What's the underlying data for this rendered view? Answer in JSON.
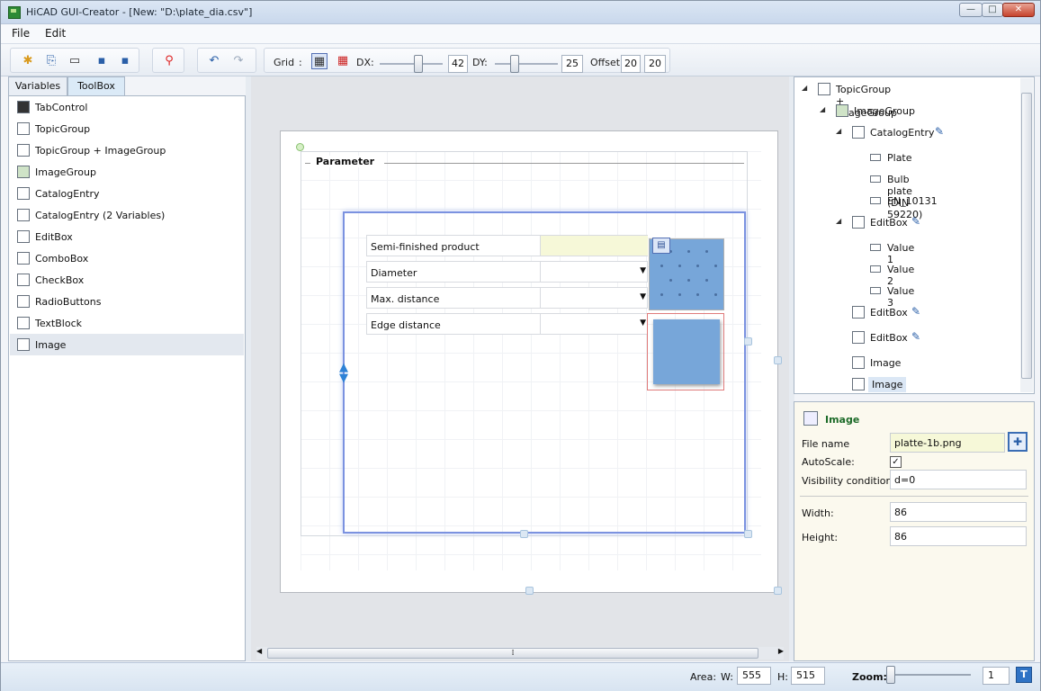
{
  "window": {
    "title": "HiCAD GUI-Creator - [New: \"D:\\plate_dia.csv\"]",
    "min": "—",
    "max": "□",
    "close": "✕"
  },
  "menu": {
    "file": "File",
    "edit": "Edit"
  },
  "toolbar": {
    "grid_label": "Grid",
    "grid_colon": ":",
    "dx_label": "DX:",
    "dx_value": "42",
    "dy_label": "DY:",
    "dy_value": "25",
    "offset_label": "Offset:",
    "offset_x": "20",
    "offset_y": "20",
    "icons": [
      "new-icon",
      "open-template-icon",
      "open-icon",
      "save-icon",
      "save-as-icon",
      "plugin-icon",
      "undo-icon",
      "redo-icon",
      "grid-toggle-icon",
      "snap-icon"
    ]
  },
  "left": {
    "tabs": [
      {
        "label": "Variables"
      },
      {
        "label": "ToolBox"
      }
    ],
    "items": [
      {
        "label": "TabControl",
        "icon": "tabcontrol-icon"
      },
      {
        "label": "TopicGroup",
        "icon": "topicgroup-icon"
      },
      {
        "label": "TopicGroup + ImageGroup",
        "icon": "topic-image-group-icon"
      },
      {
        "label": "ImageGroup",
        "icon": "imagegroup-icon"
      },
      {
        "label": "CatalogEntry",
        "icon": "catalogentry-icon"
      },
      {
        "label": "CatalogEntry (2 Variables)",
        "icon": "catalogentry2-icon"
      },
      {
        "label": "EditBox",
        "icon": "editbox-icon"
      },
      {
        "label": "ComboBox",
        "icon": "combobox-icon"
      },
      {
        "label": "CheckBox",
        "icon": "checkbox-icon"
      },
      {
        "label": "RadioButtons",
        "icon": "radiobuttons-icon"
      },
      {
        "label": "TextBlock",
        "icon": "textblock-icon"
      },
      {
        "label": "Image",
        "icon": "image-icon"
      }
    ],
    "selected": "Image"
  },
  "canvas": {
    "group_title": "Parameter",
    "rows": [
      {
        "label": "Semi-finished product",
        "value": ""
      },
      {
        "label": "Diameter",
        "value": ""
      },
      {
        "label": "Max. distance",
        "value": ""
      },
      {
        "label": "Edge distance",
        "value": ""
      }
    ]
  },
  "tree": {
    "nodes": [
      {
        "label": "TopicGroup + ImageGroup"
      },
      {
        "label": "ImageGroup"
      },
      {
        "label": "CatalogEntry"
      },
      {
        "label": "Plate"
      },
      {
        "label": "Bulb plate (DIN 59220)"
      },
      {
        "label": "EN_10131"
      },
      {
        "label": "EditBox"
      },
      {
        "label": "Value 1"
      },
      {
        "label": "Value 2"
      },
      {
        "label": "Value 3"
      },
      {
        "label": "EditBox"
      },
      {
        "label": "EditBox"
      },
      {
        "label": "Image"
      },
      {
        "label": "Image"
      }
    ]
  },
  "props": {
    "header": "Image",
    "file_name_label": "File name",
    "file_name_value": "platte-1b.png",
    "autoscale_label": "AutoScale:",
    "autoscale_checked": "✓",
    "visibility_label": "Visibility condition:",
    "visibility_value": "d=0",
    "width_label": "Width:",
    "width_value": "86",
    "height_label": "Height:",
    "height_value": "86"
  },
  "status": {
    "area_label": "Area:",
    "w_label": "W:",
    "w_value": "555",
    "h_label": "H:",
    "h_value": "515",
    "zoom_label": "Zoom:",
    "zoom_value": "1",
    "zoom_level": 0.0
  }
}
